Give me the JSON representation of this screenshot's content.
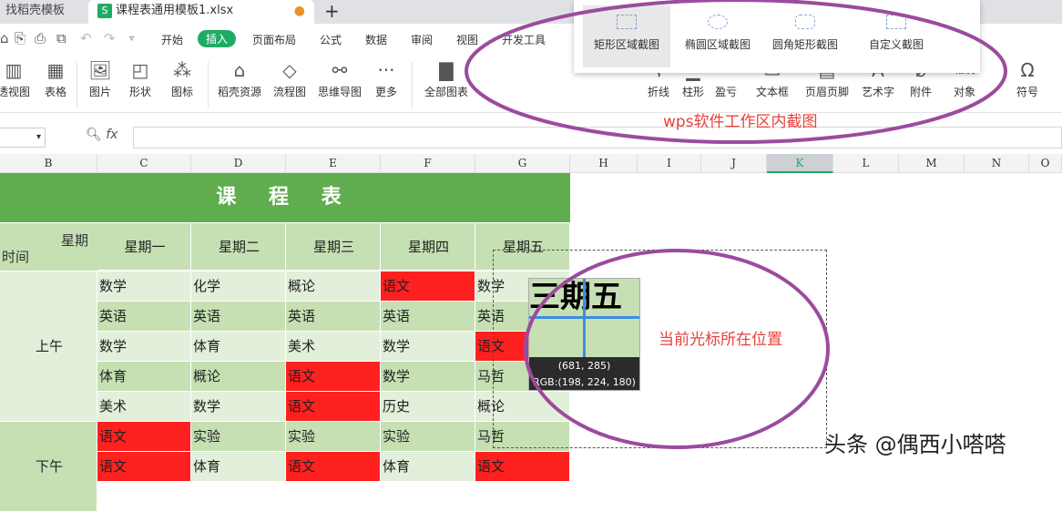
{
  "tabs": [
    {
      "label": "找稻壳模板"
    },
    {
      "label": "课程表通用模板1.xlsx",
      "icon": "S"
    }
  ],
  "menu": [
    "开始",
    "插入",
    "页面布局",
    "公式",
    "数据",
    "审阅",
    "视图",
    "开发工具"
  ],
  "ribbon": [
    "透视图",
    "表格",
    "图片",
    "形状",
    "图标",
    "稻壳资源",
    "流程图",
    "思维导图",
    "更多",
    "全部图表",
    "折线",
    "柱形",
    "盈亏",
    "文本框",
    "页眉页脚",
    "艺术字",
    "附件",
    "对象",
    "符号"
  ],
  "ribbon_extra": "相机",
  "screenshot_panel": [
    "矩形区域截图",
    "椭圆区域截图",
    "圆角矩形截图",
    "自定义截图"
  ],
  "formula": {
    "fx": "fx"
  },
  "columns": [
    "B",
    "C",
    "D",
    "E",
    "F",
    "G",
    "H",
    "I",
    "J",
    "K",
    "L",
    "M",
    "N",
    "O"
  ],
  "selected_column": "K",
  "sheet": {
    "title": "课 程 表",
    "corner_top": "星期",
    "corner_bottom": "时间",
    "days": [
      "星期一",
      "星期二",
      "星期三",
      "星期四",
      "星期五"
    ],
    "periods": [
      "上午",
      "下午"
    ],
    "rows": [
      [
        "数学",
        "化学",
        "概论",
        "语文",
        "数学"
      ],
      [
        "英语",
        "英语",
        "英语",
        "英语",
        "英语"
      ],
      [
        "数学",
        "体育",
        "美术",
        "数学",
        "语文"
      ],
      [
        "体育",
        "概论",
        "语文",
        "数学",
        "马哲"
      ],
      [
        "美术",
        "数学",
        "语文",
        "历史",
        "概论"
      ],
      [
        "语文",
        "实验",
        "实验",
        "实验",
        "马哲"
      ],
      [
        "语文",
        "体育",
        "语文",
        "体育",
        "语文"
      ]
    ],
    "highlight_color": "#ff2020",
    "highlight": [
      [
        0,
        3
      ],
      [
        2,
        4
      ],
      [
        3,
        2
      ],
      [
        4,
        2
      ],
      [
        5,
        0
      ],
      [
        6,
        0
      ],
      [
        6,
        2
      ],
      [
        6,
        4
      ]
    ]
  },
  "magnifier": {
    "preview": "三期五",
    "coords": "(681, 285)",
    "rgb": "RGB:(198, 224, 180)"
  },
  "annotations": {
    "toolbar": "wps软件工作区内截图",
    "cursor": "当前光标所在位置"
  },
  "watermark": "头条 @偶西小嗒嗒"
}
